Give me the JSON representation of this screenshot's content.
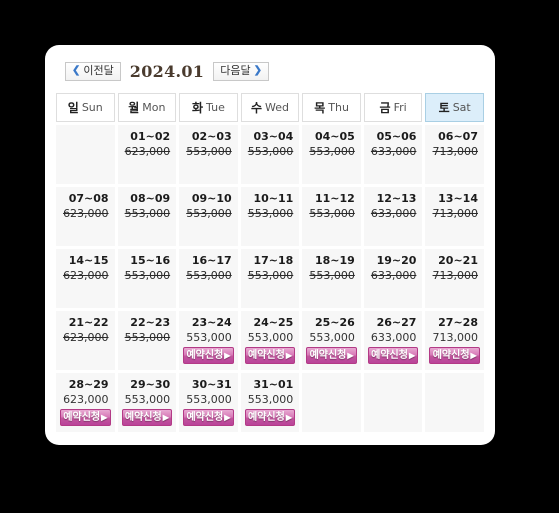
{
  "nav": {
    "prev_label": "이전달",
    "next_label": "다음달",
    "prev_icon": "chevron-left-icon",
    "next_icon": "chevron-right-icon",
    "month_title": "2024.01"
  },
  "weekdays": [
    {
      "ko": "일",
      "en": "Sun",
      "highlight": false
    },
    {
      "ko": "월",
      "en": "Mon",
      "highlight": false
    },
    {
      "ko": "화",
      "en": "Tue",
      "highlight": false
    },
    {
      "ko": "수",
      "en": "Wed",
      "highlight": false
    },
    {
      "ko": "목",
      "en": "Thu",
      "highlight": false
    },
    {
      "ko": "금",
      "en": "Fri",
      "highlight": false
    },
    {
      "ko": "토",
      "en": "Sat",
      "highlight": true
    }
  ],
  "book_button_label": "예약신청",
  "book_button_arrow": "▶",
  "colors": {
    "accent_pink": "#c2569d",
    "saturday_header": "#dceefa",
    "cell_background": "#f7f7f7",
    "panel_background": "#ffffff",
    "page_background": "#000000",
    "chevron_blue": "#3a78c8",
    "month_title": "#4a3b2e"
  },
  "weeks": [
    [
      {
        "type": "empty"
      },
      {
        "type": "day",
        "range": "01~02",
        "price": "623,000",
        "available": false
      },
      {
        "type": "day",
        "range": "02~03",
        "price": "553,000",
        "available": false
      },
      {
        "type": "day",
        "range": "03~04",
        "price": "553,000",
        "available": false
      },
      {
        "type": "day",
        "range": "04~05",
        "price": "553,000",
        "available": false
      },
      {
        "type": "day",
        "range": "05~06",
        "price": "633,000",
        "available": false
      },
      {
        "type": "day",
        "range": "06~07",
        "price": "713,000",
        "available": false
      }
    ],
    [
      {
        "type": "day",
        "range": "07~08",
        "price": "623,000",
        "available": false
      },
      {
        "type": "day",
        "range": "08~09",
        "price": "553,000",
        "available": false
      },
      {
        "type": "day",
        "range": "09~10",
        "price": "553,000",
        "available": false
      },
      {
        "type": "day",
        "range": "10~11",
        "price": "553,000",
        "available": false
      },
      {
        "type": "day",
        "range": "11~12",
        "price": "553,000",
        "available": false
      },
      {
        "type": "day",
        "range": "12~13",
        "price": "633,000",
        "available": false
      },
      {
        "type": "day",
        "range": "13~14",
        "price": "713,000",
        "available": false
      }
    ],
    [
      {
        "type": "day",
        "range": "14~15",
        "price": "623,000",
        "available": false
      },
      {
        "type": "day",
        "range": "15~16",
        "price": "553,000",
        "available": false
      },
      {
        "type": "day",
        "range": "16~17",
        "price": "553,000",
        "available": false
      },
      {
        "type": "day",
        "range": "17~18",
        "price": "553,000",
        "available": false
      },
      {
        "type": "day",
        "range": "18~19",
        "price": "553,000",
        "available": false
      },
      {
        "type": "day",
        "range": "19~20",
        "price": "633,000",
        "available": false
      },
      {
        "type": "day",
        "range": "20~21",
        "price": "713,000",
        "available": false
      }
    ],
    [
      {
        "type": "day",
        "range": "21~22",
        "price": "623,000",
        "available": false
      },
      {
        "type": "day",
        "range": "22~23",
        "price": "553,000",
        "available": false
      },
      {
        "type": "day",
        "range": "23~24",
        "price": "553,000",
        "available": true
      },
      {
        "type": "day",
        "range": "24~25",
        "price": "553,000",
        "available": true
      },
      {
        "type": "day",
        "range": "25~26",
        "price": "553,000",
        "available": true
      },
      {
        "type": "day",
        "range": "26~27",
        "price": "633,000",
        "available": true
      },
      {
        "type": "day",
        "range": "27~28",
        "price": "713,000",
        "available": true
      }
    ],
    [
      {
        "type": "day",
        "range": "28~29",
        "price": "623,000",
        "available": true
      },
      {
        "type": "day",
        "range": "29~30",
        "price": "553,000",
        "available": true
      },
      {
        "type": "day",
        "range": "30~31",
        "price": "553,000",
        "available": true
      },
      {
        "type": "day",
        "range": "31~01",
        "price": "553,000",
        "available": true
      },
      {
        "type": "empty"
      },
      {
        "type": "empty"
      },
      {
        "type": "empty"
      }
    ]
  ]
}
